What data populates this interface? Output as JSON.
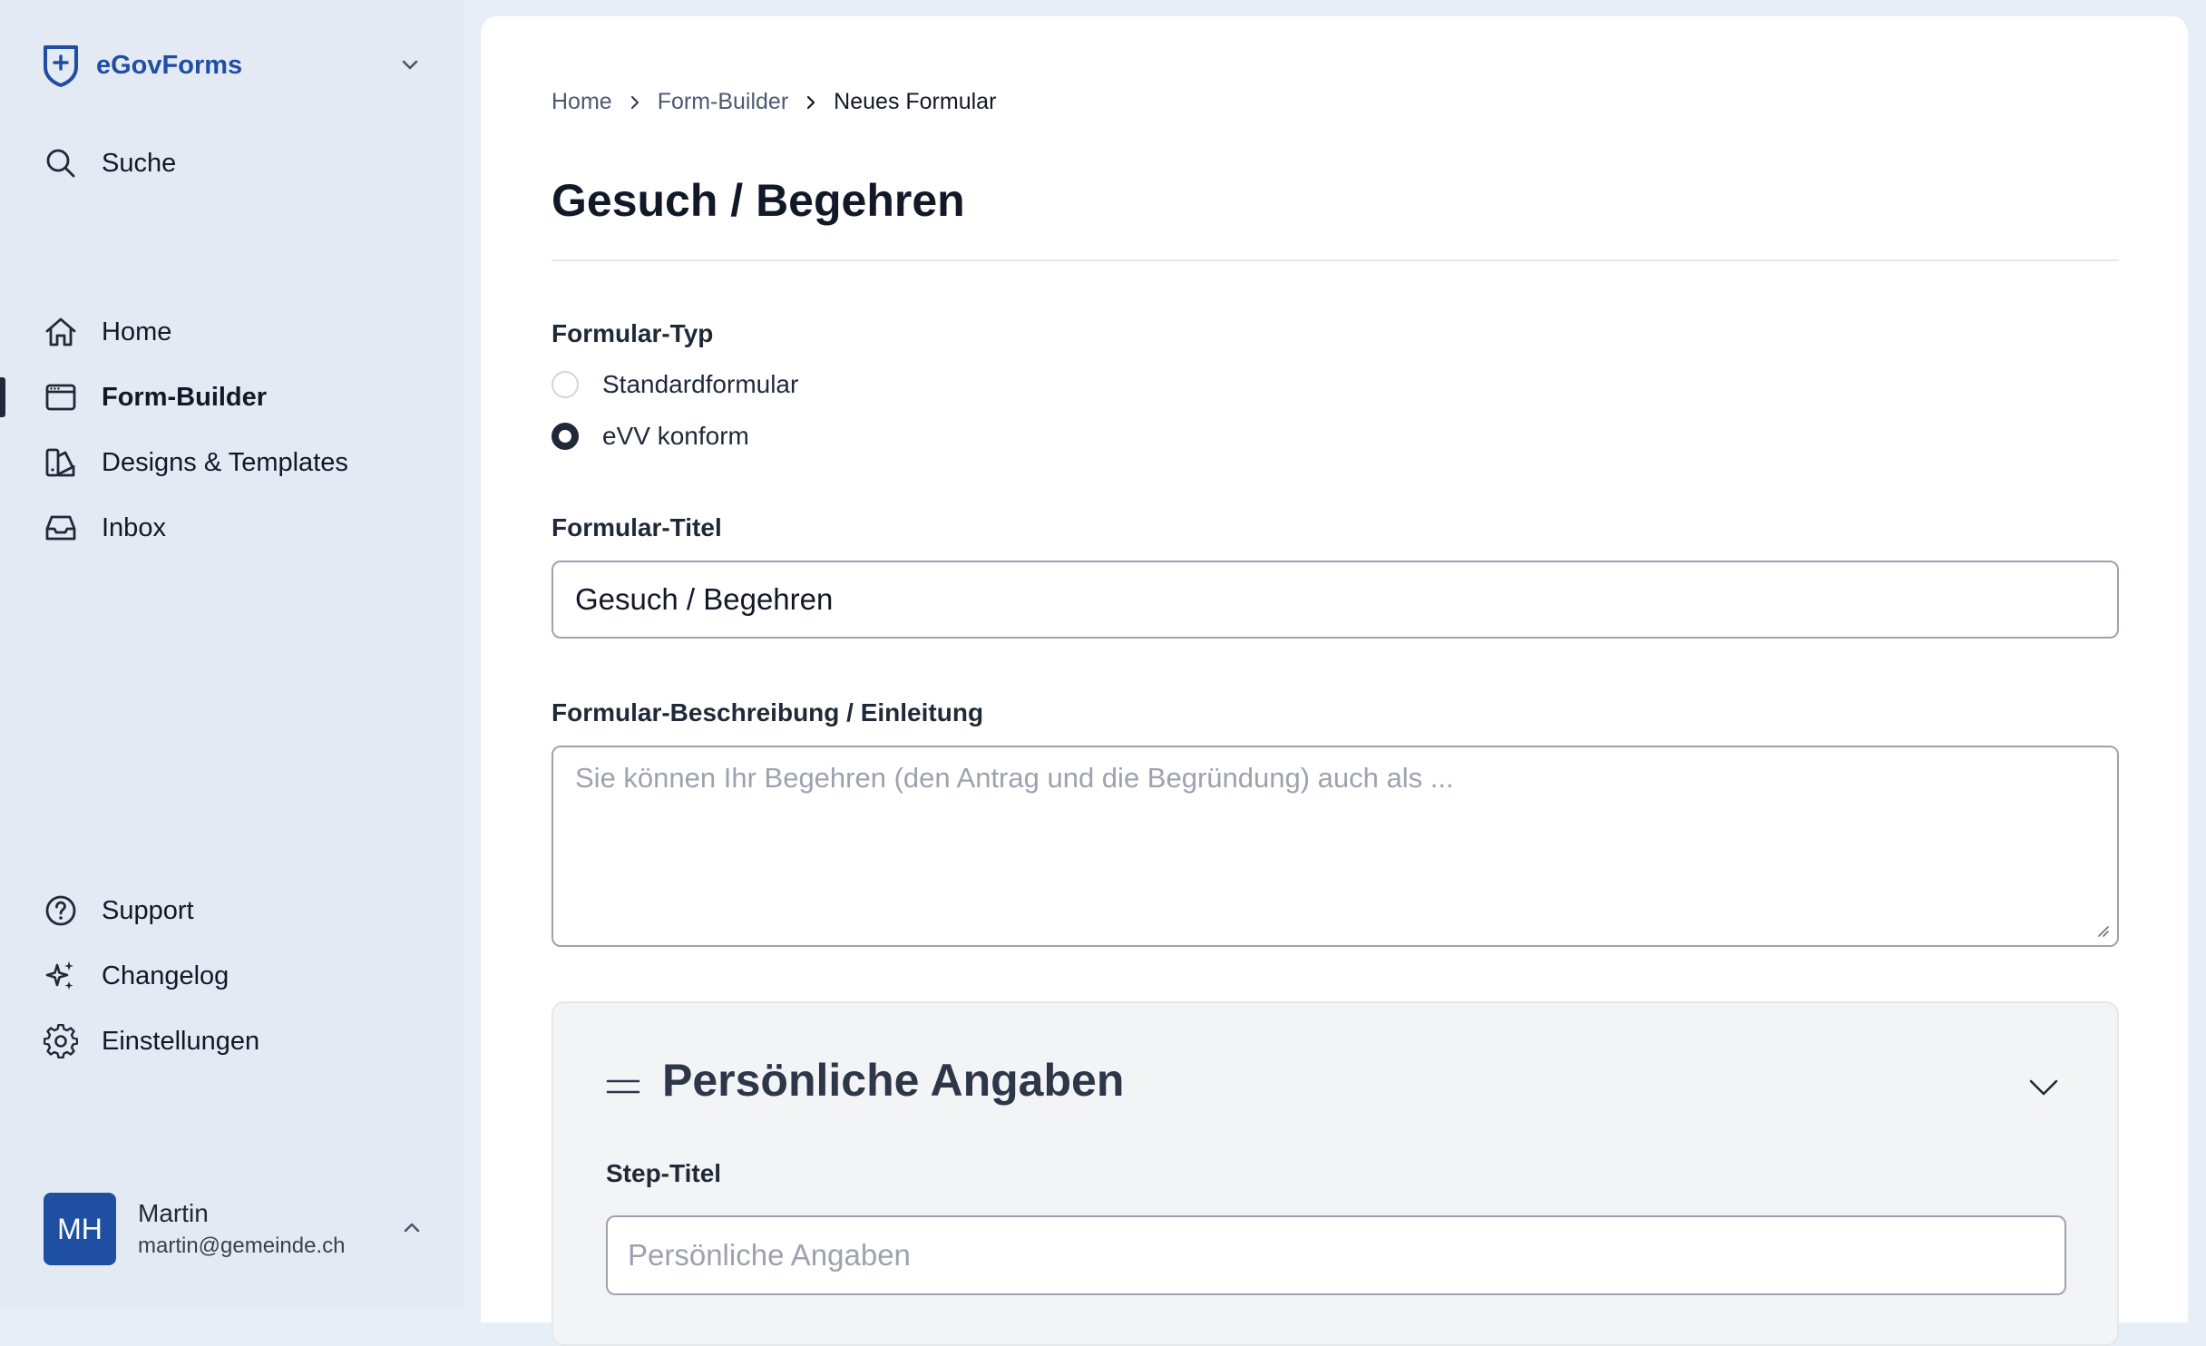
{
  "brand": {
    "name": "eGovForms",
    "logo_icon": "shield-plus-icon",
    "accent": "#1f4ea3"
  },
  "sidebar": {
    "search_label": "Suche",
    "nav": [
      {
        "label": "Home",
        "icon": "home-icon",
        "active": false
      },
      {
        "label": "Form-Builder",
        "icon": "browser-window-icon",
        "active": true
      },
      {
        "label": "Designs & Templates",
        "icon": "swatch-icon",
        "active": false
      },
      {
        "label": "Inbox",
        "icon": "inbox-icon",
        "active": false
      }
    ],
    "footer_nav": [
      {
        "label": "Support",
        "icon": "question-circle-icon"
      },
      {
        "label": "Changelog",
        "icon": "sparkles-icon"
      },
      {
        "label": "Einstellungen",
        "icon": "gear-icon"
      }
    ],
    "user": {
      "initials": "MH",
      "name": "Martin",
      "email": "martin@gemeinde.ch"
    }
  },
  "breadcrumb": {
    "items": [
      "Home",
      "Form-Builder"
    ],
    "current": "Neues Formular"
  },
  "page": {
    "title": "Gesuch / Begehren"
  },
  "form": {
    "type_label": "Formular-Typ",
    "type_options": [
      {
        "label": "Standardformular",
        "checked": false
      },
      {
        "label": "eVV konform",
        "checked": true
      }
    ],
    "title_label": "Formular-Titel",
    "title_value": "Gesuch / Begehren",
    "description_label": "Formular-Beschreibung / Einleitung",
    "description_placeholder": "Sie können Ihr Begehren (den Antrag und die Begründung) auch als ..."
  },
  "step": {
    "title": "Persönliche Angaben",
    "field_label": "Step-Titel",
    "field_placeholder": "Persönliche Angaben"
  }
}
